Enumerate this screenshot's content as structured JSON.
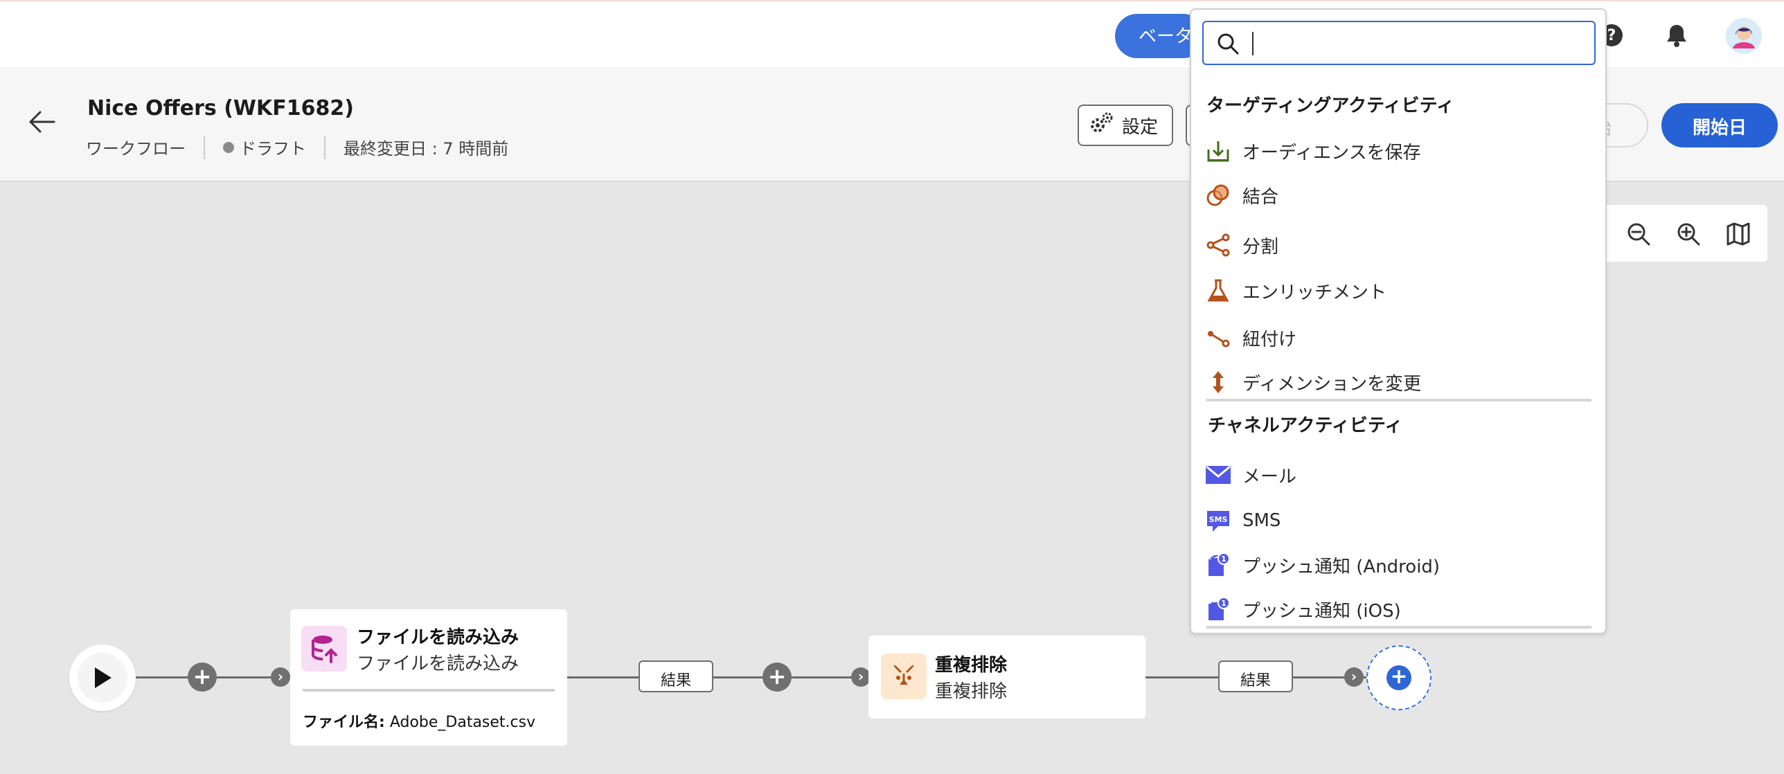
{
  "shell": {
    "beta_label": "ベータ"
  },
  "header": {
    "title": "Nice Offers (WKF1682)",
    "type": "ワークフロー",
    "status": "ドラフト",
    "last_modified": "最終変更日 : 7 時間前",
    "settings_label": "設定",
    "start_ghost_label": "開始",
    "start_label": "開始日"
  },
  "search": {
    "placeholder": ""
  },
  "dropdown": {
    "targeting_title": "ターゲティングアクティビティ",
    "targeting_items": [
      {
        "label": "オーディエンスを保存",
        "icon": "save-audience-icon"
      },
      {
        "label": "結合",
        "icon": "combine-icon"
      },
      {
        "label": "分割",
        "icon": "split-icon"
      },
      {
        "label": "エンリッチメント",
        "icon": "enrichment-flask-icon"
      },
      {
        "label": "紐付け",
        "icon": "reconciliation-icon"
      },
      {
        "label": "ディメンションを変更",
        "icon": "change-dimension-icon"
      }
    ],
    "channel_title": "チャネルアクティビティ",
    "channel_items": [
      {
        "label": "メール",
        "icon": "email-icon"
      },
      {
        "label": "SMS",
        "icon": "sms-icon"
      },
      {
        "label": "プッシュ通知 (Android)",
        "icon": "push-android-icon"
      },
      {
        "label": "プッシュ通知 (iOS)",
        "icon": "push-ios-icon"
      }
    ]
  },
  "canvas": {
    "load_file": {
      "title": "ファイルを読み込み",
      "subtitle": "ファイルを読み込み",
      "file_label": "ファイル名:",
      "file_value": "Adobe_Dataset.csv"
    },
    "result_label_1": "結果",
    "dedup": {
      "title": "重複排除",
      "subtitle": "重複排除"
    },
    "result_label_2": "結果"
  },
  "colors": {
    "primary": "#2661d6",
    "targeting_icon": "#b4521a",
    "channel_icon": "#5258e4",
    "load_icon_bg": "#f8def4",
    "dedup_icon_bg": "#fde8cf"
  }
}
